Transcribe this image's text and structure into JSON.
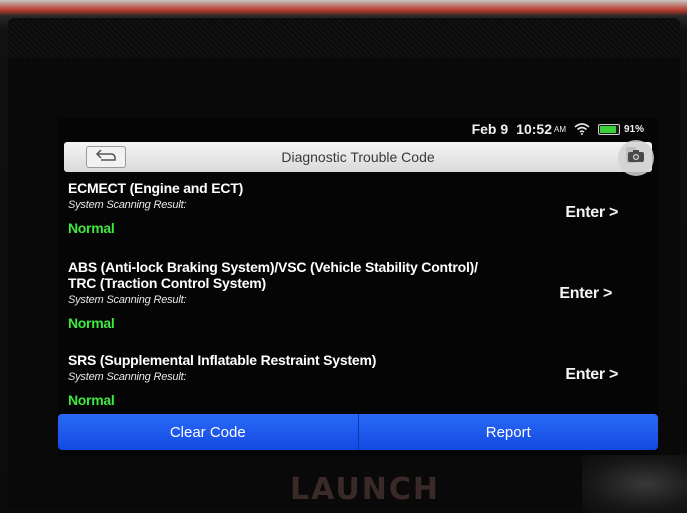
{
  "status_bar": {
    "date": "Feb 9",
    "time": "10:52",
    "ampm": "AM",
    "battery_percent": "91%",
    "battery_level": 0.91,
    "icons": [
      "wifi-icon",
      "battery-icon"
    ]
  },
  "header": {
    "title": "Diagnostic Trouble Code",
    "back_icon": "back-arrow-icon",
    "doc_icon": "document-icon",
    "camera_icon": "camera-icon"
  },
  "systems": [
    {
      "name": "ECMECT (Engine and ECT)",
      "result_label": "System Scanning Result:",
      "status": "Normal",
      "action": "Enter >"
    },
    {
      "name": "ABS (Anti-lock Braking System)/VSC (Vehicle Stability Control)/ TRC (Traction Control System)",
      "name_line1": "ABS (Anti-lock Braking System)/VSC (Vehicle Stability Control)/",
      "name_line2": "TRC (Traction Control System)",
      "result_label": "System Scanning Result:",
      "status": "Normal",
      "action": "Enter >"
    },
    {
      "name": "SRS (Supplemental Inflatable Restraint System)",
      "result_label": "System Scanning Result:",
      "status": "Normal",
      "action": "Enter >"
    }
  ],
  "bottom_bar": {
    "clear_code": "Clear Code",
    "report": "Report"
  },
  "device": {
    "brand": "LAUNCH"
  },
  "colors": {
    "status_normal": "#3fe83f",
    "button_blue": "#1f5cf0",
    "titlebar_bg": "#e6e6e6",
    "screen_bg": "#050505"
  }
}
